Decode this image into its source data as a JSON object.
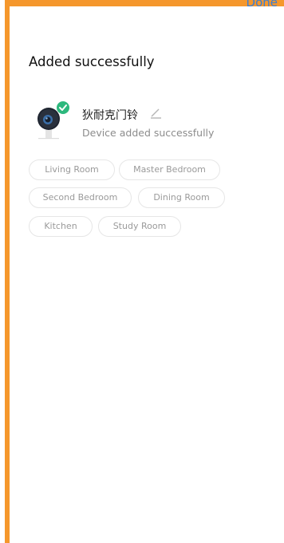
{
  "header": {
    "done_label": "Done",
    "title": "Added successfully"
  },
  "device": {
    "name": "狄耐克门铃",
    "status": "Device added successfully",
    "icon": "camera-icon",
    "badge_icon": "check-icon",
    "edit_icon": "pencil-icon"
  },
  "rooms": [
    "Living Room",
    "Master Bedroom",
    "Second Bedroom",
    "Dining Room",
    "Kitchen",
    "Study Room"
  ],
  "colors": {
    "accent_border": "#f5972c",
    "done_link": "#3a7fd5",
    "success_badge": "#2db87d"
  }
}
